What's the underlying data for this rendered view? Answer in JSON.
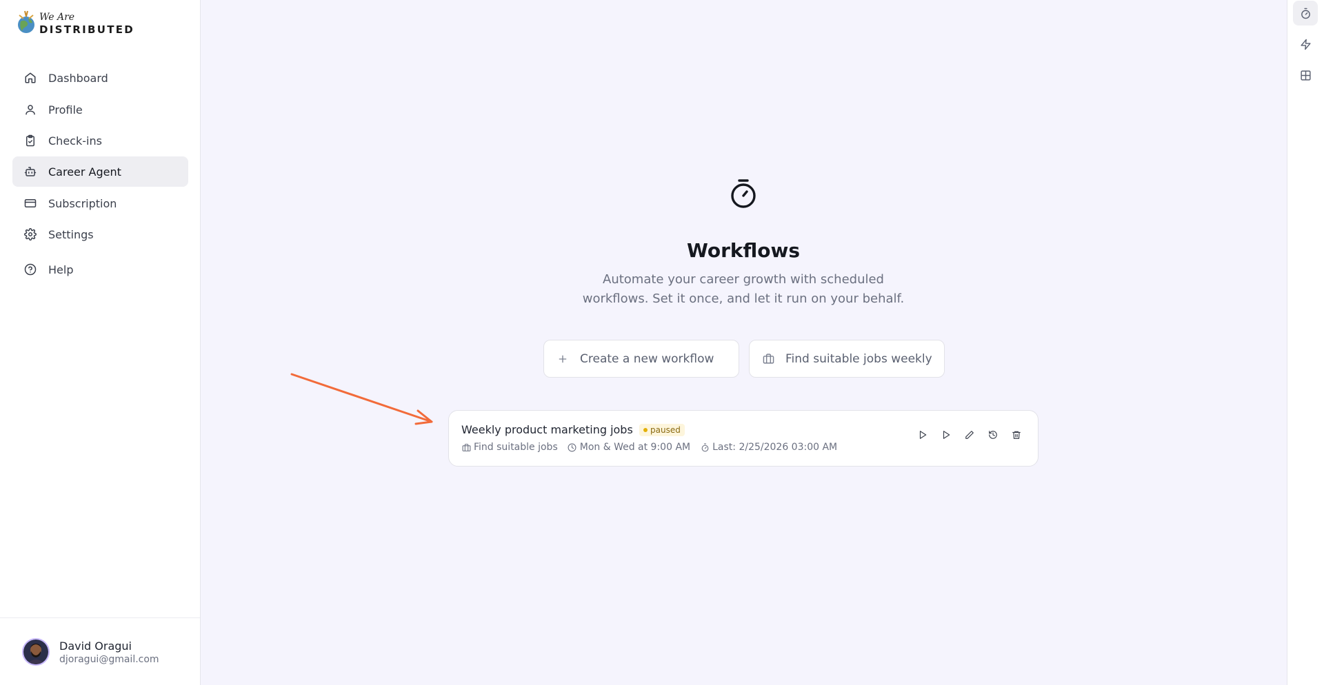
{
  "brand": {
    "logo_small": "We Are",
    "logo_big": "DISTRIBUTED"
  },
  "sidebar": {
    "items": [
      {
        "label": "Dashboard",
        "icon": "home-icon",
        "active": false
      },
      {
        "label": "Profile",
        "icon": "user-icon",
        "active": false
      },
      {
        "label": "Check-ins",
        "icon": "clipboard-check-icon",
        "active": false
      },
      {
        "label": "Career Agent",
        "icon": "bot-icon",
        "active": true
      },
      {
        "label": "Subscription",
        "icon": "credit-card-icon",
        "active": false
      },
      {
        "label": "Settings",
        "icon": "gear-icon",
        "active": false
      },
      {
        "label": "Help",
        "icon": "help-circle-icon",
        "active": false
      }
    ]
  },
  "user": {
    "name": "David Oragui",
    "email": "djoragui@gmail.com"
  },
  "right_rail": {
    "items": [
      {
        "icon": "timer-icon",
        "active": true
      },
      {
        "icon": "zap-icon",
        "active": false
      },
      {
        "icon": "grid-icon",
        "active": false
      }
    ]
  },
  "main": {
    "title": "Workflows",
    "subtitle": "Automate your career growth with scheduled workflows. Set it once, and let it run on your behalf.",
    "actions": [
      {
        "label": "Create a new workflow",
        "icon": "plus-icon"
      },
      {
        "label": "Find suitable jobs weekly",
        "icon": "briefcase-icon"
      }
    ],
    "workflows": [
      {
        "name": "Weekly product marketing jobs",
        "status": "paused",
        "type": "Find suitable jobs",
        "schedule": "Mon & Wed at 9:00 AM",
        "last_run": "Last: 2/25/2026 03:00 AM"
      }
    ]
  },
  "colors": {
    "background": "#f5f4fd",
    "annotation_arrow": "#f26b3a",
    "paused_badge_bg": "#fdf5dc",
    "paused_dot": "#e3b008"
  }
}
